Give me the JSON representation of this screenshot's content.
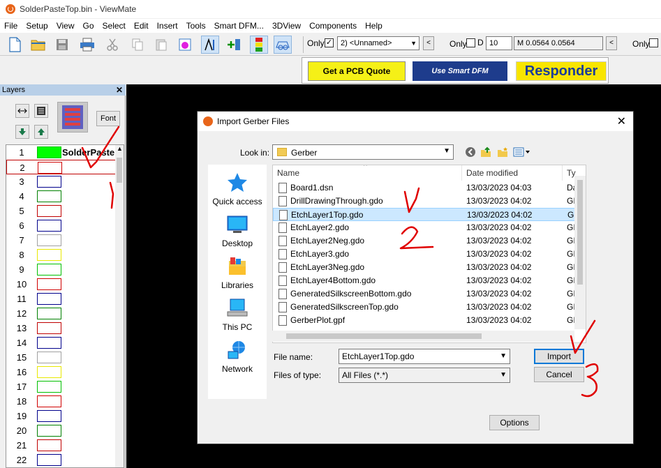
{
  "window": {
    "title": "SolderPasteTop.bin - ViewMate"
  },
  "menu": [
    "File",
    "Setup",
    "View",
    "Go",
    "Select",
    "Edit",
    "Insert",
    "Tools",
    "Smart DFM...",
    "3DView",
    "Components",
    "Help"
  ],
  "toolbar": {
    "only_label_1": "Only",
    "layer_select_value": "2) <Unnamed>",
    "only_label_2": "Only",
    "d_label": "D",
    "d_value": "10",
    "m_readout": "M 0.0564  0.0564",
    "only_label_3": "Only"
  },
  "ads": {
    "quote": "Get a PCB Quote",
    "smart_dfm": "Use Smart DFM",
    "responder": "Responder"
  },
  "layers_panel": {
    "title": "Layers",
    "font_button": "Font",
    "rows": [
      {
        "num": "1",
        "color": "#00ff00",
        "border": "#00c000",
        "filled": true,
        "name": "SolderPaste"
      },
      {
        "num": "2",
        "color": "#ffffff",
        "border": "#d00000",
        "filled": false,
        "name": ""
      },
      {
        "num": "3",
        "color": "#ffffff",
        "border": "#00008b",
        "filled": false,
        "name": ""
      },
      {
        "num": "4",
        "color": "#ffffff",
        "border": "#008000",
        "filled": false,
        "name": ""
      },
      {
        "num": "5",
        "color": "#ffffff",
        "border": "#c00000",
        "filled": false,
        "name": ""
      },
      {
        "num": "6",
        "color": "#ffffff",
        "border": "#00008b",
        "filled": false,
        "name": ""
      },
      {
        "num": "7",
        "color": "#ffffff",
        "border": "#a0a0a0",
        "filled": false,
        "name": ""
      },
      {
        "num": "8",
        "color": "#ffffff",
        "border": "#e8e800",
        "filled": false,
        "name": ""
      },
      {
        "num": "9",
        "color": "#ffffff",
        "border": "#00c000",
        "filled": false,
        "name": ""
      },
      {
        "num": "10",
        "color": "#ffffff",
        "border": "#d00000",
        "filled": false,
        "name": ""
      },
      {
        "num": "11",
        "color": "#ffffff",
        "border": "#00008b",
        "filled": false,
        "name": ""
      },
      {
        "num": "12",
        "color": "#ffffff",
        "border": "#008000",
        "filled": false,
        "name": ""
      },
      {
        "num": "13",
        "color": "#ffffff",
        "border": "#c00000",
        "filled": false,
        "name": ""
      },
      {
        "num": "14",
        "color": "#ffffff",
        "border": "#00008b",
        "filled": false,
        "name": ""
      },
      {
        "num": "15",
        "color": "#ffffff",
        "border": "#a0a0a0",
        "filled": false,
        "name": ""
      },
      {
        "num": "16",
        "color": "#ffffff",
        "border": "#e8e800",
        "filled": false,
        "name": ""
      },
      {
        "num": "17",
        "color": "#ffffff",
        "border": "#00c000",
        "filled": false,
        "name": ""
      },
      {
        "num": "18",
        "color": "#ffffff",
        "border": "#d00000",
        "filled": false,
        "name": ""
      },
      {
        "num": "19",
        "color": "#ffffff",
        "border": "#00008b",
        "filled": false,
        "name": ""
      },
      {
        "num": "20",
        "color": "#ffffff",
        "border": "#008000",
        "filled": false,
        "name": ""
      },
      {
        "num": "21",
        "color": "#ffffff",
        "border": "#c00000",
        "filled": false,
        "name": ""
      },
      {
        "num": "22",
        "color": "#ffffff",
        "border": "#00008b",
        "filled": false,
        "name": ""
      }
    ]
  },
  "dialog": {
    "title": "Import Gerber Files",
    "look_in_label": "Look in:",
    "look_in_value": "Gerber",
    "places": [
      "Quick access",
      "Desktop",
      "Libraries",
      "This PC",
      "Network"
    ],
    "columns": {
      "name": "Name",
      "date": "Date modified",
      "type": "Ty"
    },
    "files": [
      {
        "name": "Board1.dsn",
        "date": "13/03/2023 04:03",
        "type": "Da",
        "selected": false
      },
      {
        "name": "DrillDrawingThrough.gdo",
        "date": "13/03/2023 04:02",
        "type": "GI",
        "selected": false
      },
      {
        "name": "EtchLayer1Top.gdo",
        "date": "13/03/2023 04:02",
        "type": "GI",
        "selected": true
      },
      {
        "name": "EtchLayer2.gdo",
        "date": "13/03/2023 04:02",
        "type": "GI",
        "selected": false
      },
      {
        "name": "EtchLayer2Neg.gdo",
        "date": "13/03/2023 04:02",
        "type": "GI",
        "selected": false
      },
      {
        "name": "EtchLayer3.gdo",
        "date": "13/03/2023 04:02",
        "type": "GI",
        "selected": false
      },
      {
        "name": "EtchLayer3Neg.gdo",
        "date": "13/03/2023 04:02",
        "type": "GI",
        "selected": false
      },
      {
        "name": "EtchLayer4Bottom.gdo",
        "date": "13/03/2023 04:02",
        "type": "GI",
        "selected": false
      },
      {
        "name": "GeneratedSilkscreenBottom.gdo",
        "date": "13/03/2023 04:02",
        "type": "GI",
        "selected": false
      },
      {
        "name": "GeneratedSilkscreenTop.gdo",
        "date": "13/03/2023 04:02",
        "type": "GI",
        "selected": false
      },
      {
        "name": "GerberPlot.gpf",
        "date": "13/03/2023 04:02",
        "type": "GI",
        "selected": false
      }
    ],
    "file_name_label": "File name:",
    "file_name_value": "EtchLayer1Top.gdo",
    "file_type_label": "Files of type:",
    "file_type_value": "All Files (*.*)",
    "import_button": "Import",
    "cancel_button": "Cancel",
    "options_button": "Options"
  },
  "annotation_color": "#e00000"
}
